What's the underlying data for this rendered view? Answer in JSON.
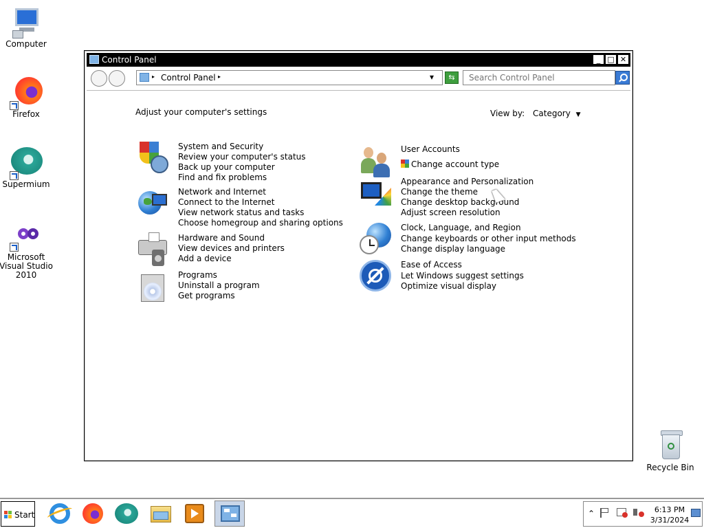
{
  "desktop": {
    "icons": [
      {
        "label": "Computer"
      },
      {
        "label": "Firefox"
      },
      {
        "label": "Supermium"
      },
      {
        "label": "Microsoft Visual Studio 2010"
      },
      {
        "label": "Recycle Bin"
      }
    ]
  },
  "window": {
    "title": "Control Panel",
    "buttons": {
      "minimize": "_",
      "maximize": "□",
      "close": "✕"
    },
    "address": {
      "crumb": "Control Panel",
      "dropdown": "▾",
      "sep": "▸"
    },
    "search": {
      "placeholder": "Search Control Panel"
    },
    "heading": "Adjust your computer's settings",
    "view_by": {
      "label": "View by:",
      "value": "Category",
      "caret": "▼"
    },
    "categories_left": [
      {
        "title": "System and Security",
        "links": [
          "Review your computer's status",
          "Back up your computer",
          "Find and fix problems"
        ]
      },
      {
        "title": "Network and Internet",
        "links": [
          "Connect to the Internet",
          "View network status and tasks",
          "Choose homegroup and sharing options"
        ]
      },
      {
        "title": "Hardware and Sound",
        "links": [
          "View devices and printers",
          "Add a device"
        ]
      },
      {
        "title": "Programs",
        "links": [
          "Uninstall a program",
          "Get programs"
        ]
      }
    ],
    "categories_right": [
      {
        "title": "User Accounts",
        "links": [
          "Change account type"
        ]
      },
      {
        "title": "Appearance and Personalization",
        "links": [
          "Change the theme",
          "Change desktop background",
          "Adjust screen resolution"
        ]
      },
      {
        "title": "Clock, Language, and Region",
        "links": [
          "Change keyboards or other input methods",
          "Change display language"
        ]
      },
      {
        "title": "Ease of Access",
        "links": [
          "Let Windows suggest settings",
          "Optimize visual display"
        ]
      }
    ]
  },
  "taskbar": {
    "start_label": "Start",
    "pinned": [
      "internet-explorer-icon",
      "firefox-icon",
      "supermium-icon",
      "file-explorer-icon",
      "media-player-icon",
      "control-panel-icon"
    ],
    "tray": {
      "expand": "⌃",
      "time": "6:13 PM",
      "date": "3/31/2024"
    }
  },
  "colors": {
    "window_frame": "#000000",
    "title_text": "#ffffff",
    "accent": "#3a7bd5"
  }
}
